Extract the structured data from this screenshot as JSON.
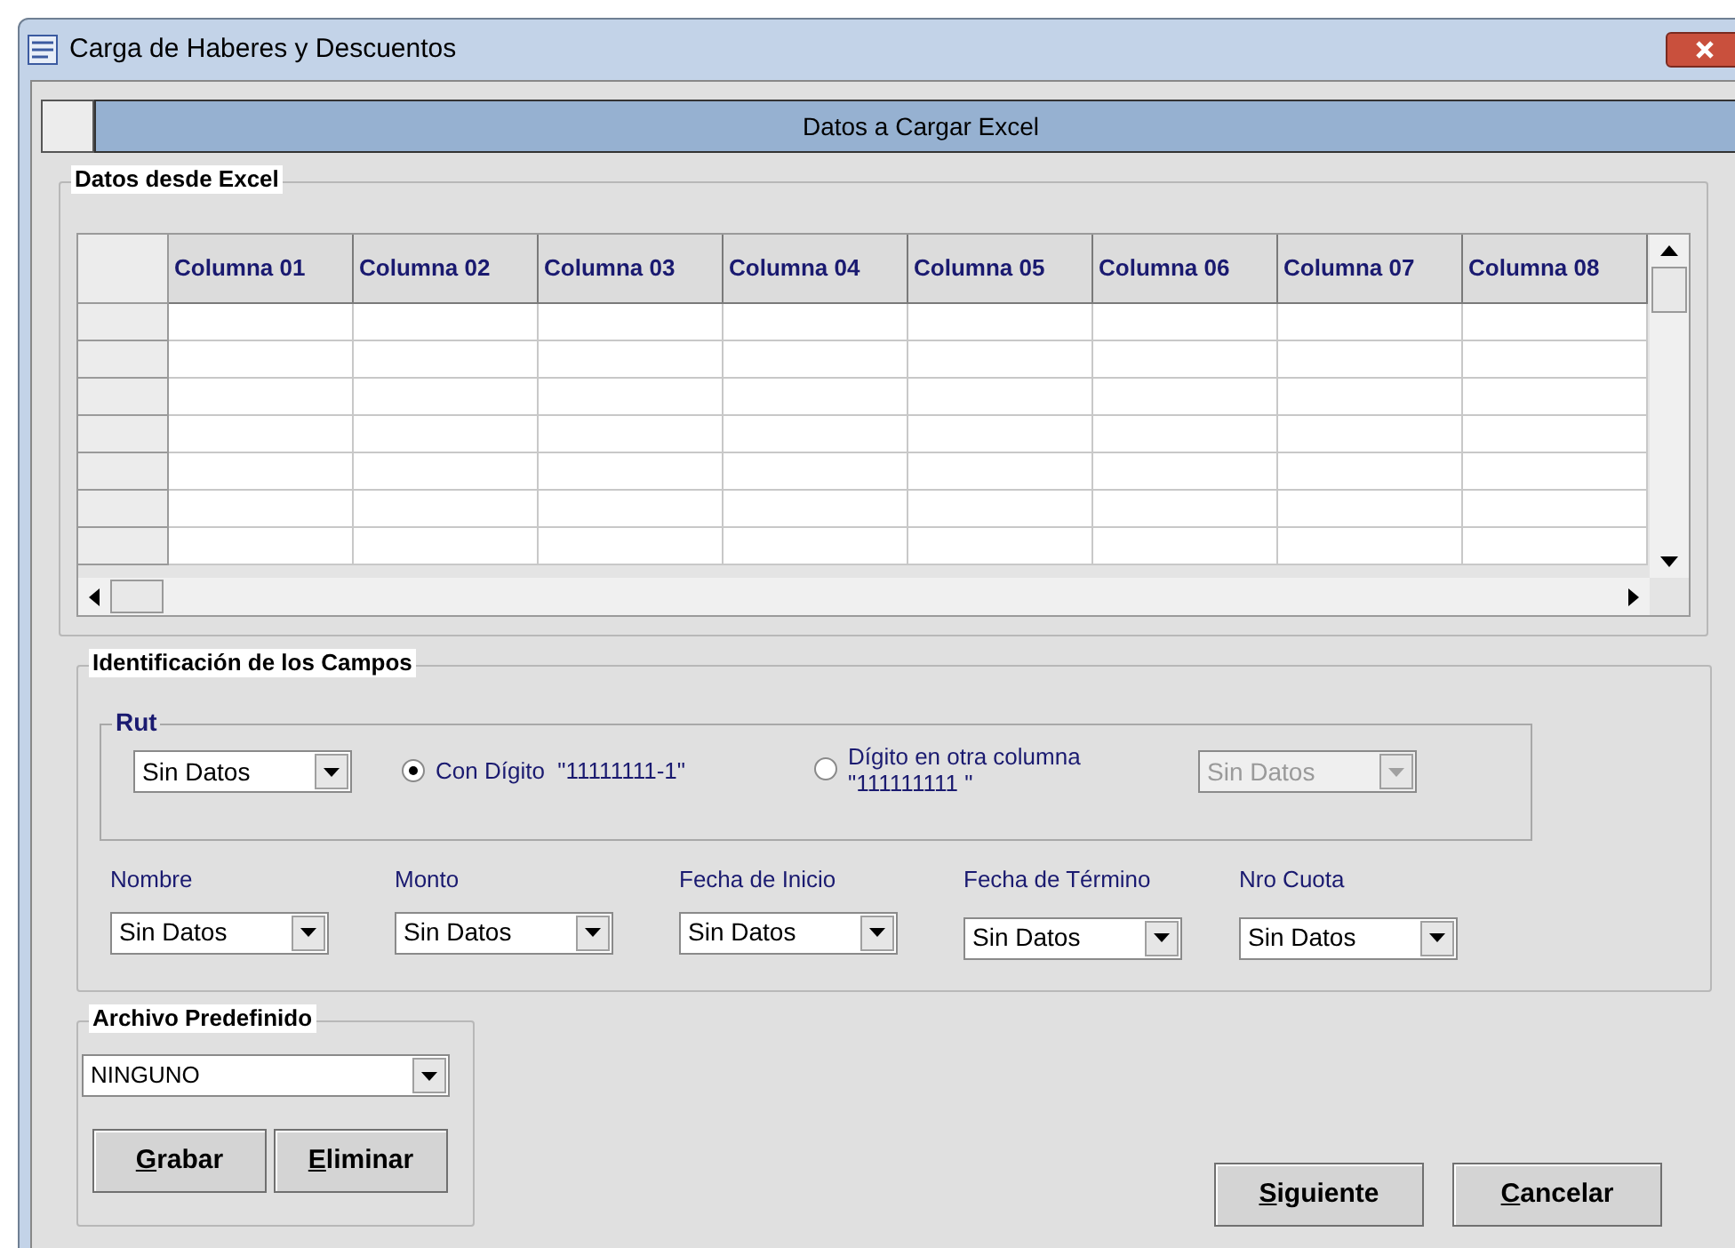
{
  "window": {
    "title": "Carga de Haberes y Descuentos"
  },
  "tab_header": {
    "title": "Datos a Cargar Excel"
  },
  "excel_group": {
    "title": "Datos desde Excel",
    "columns": [
      "Columna 01",
      "Columna 02",
      "Columna 03",
      "Columna 04",
      "Columna 05",
      "Columna 06",
      "Columna 07",
      "Columna 08"
    ]
  },
  "fields_group": {
    "title": "Identificación de los Campos",
    "rut": {
      "title": "Rut",
      "combo": {
        "value": "Sin Datos",
        "disabled": false
      },
      "radios": [
        {
          "label": "Con Dígito  \"11111111-1\"",
          "selected": true
        },
        {
          "label": "Dígito en otra columna\n\"111111111 \"",
          "selected": false
        }
      ],
      "digit_combo": {
        "value": "Sin Datos",
        "disabled": true
      }
    },
    "fields": [
      {
        "label": "Nombre",
        "value": "Sin Datos"
      },
      {
        "label": "Monto",
        "value": "Sin Datos"
      },
      {
        "label": "Fecha de Inicio",
        "value": "Sin Datos"
      },
      {
        "label": "Fecha de Término",
        "value": "Sin Datos"
      },
      {
        "label": "Nro Cuota",
        "value": "Sin Datos"
      }
    ]
  },
  "preset_group": {
    "title": "Archivo Predefinido",
    "combo": {
      "value": "NINGUNO"
    },
    "buttons": [
      "Grabar",
      "Eliminar"
    ]
  },
  "actions": [
    "Siguiente",
    "Cancelar"
  ]
}
